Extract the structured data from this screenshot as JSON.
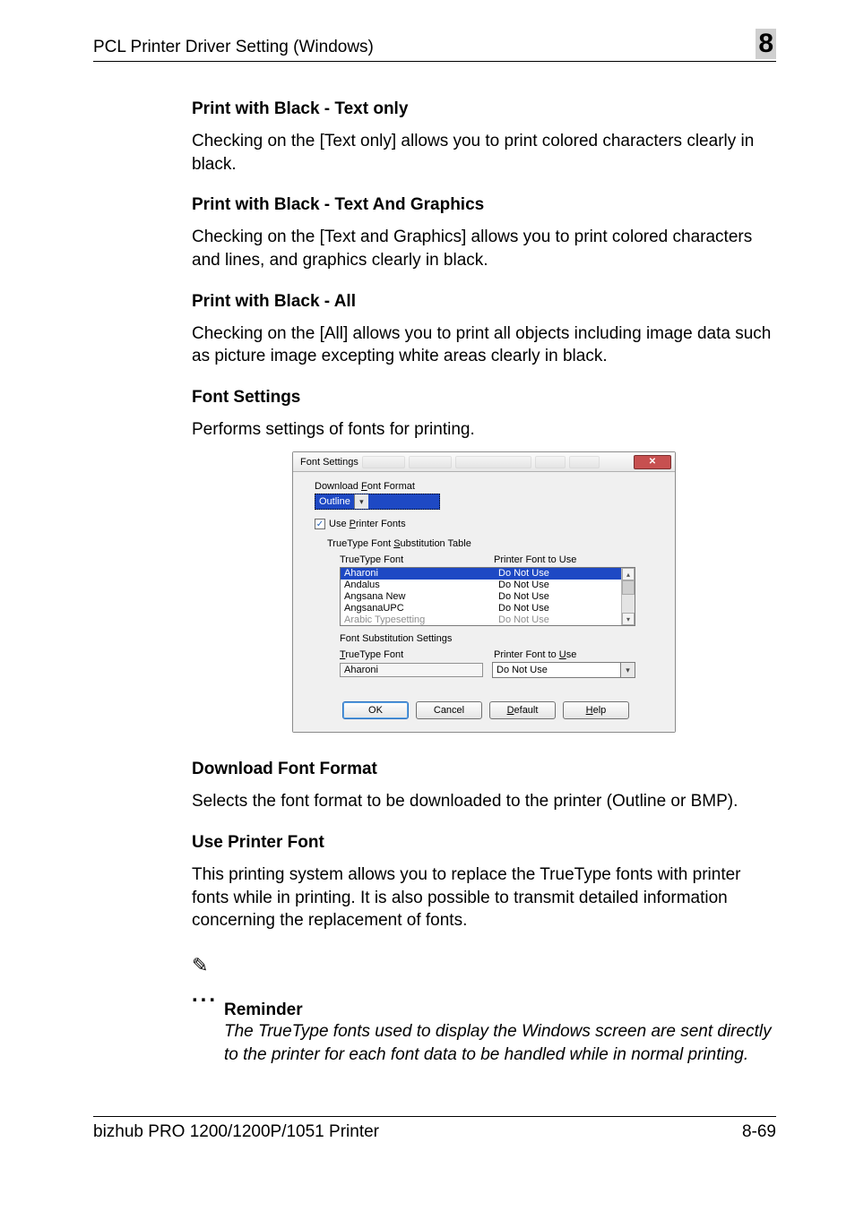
{
  "header": {
    "title": "PCL Printer Driver Setting (Windows)",
    "chapter": "8"
  },
  "sections": {
    "s1_title": "Print with Black - Text only",
    "s1_body": "Checking on the [Text only] allows you to print colored characters clearly in black.",
    "s2_title": "Print with Black - Text And Graphics",
    "s2_body": "Checking on the [Text and Graphics] allows you to print colored characters and lines, and graphics clearly in black.",
    "s3_title": "Print with Black - All",
    "s3_body": "Checking on the [All] allows you to print all objects including image data such as picture image excepting white areas clearly in black.",
    "s4_title": "Font Settings",
    "s4_body": "Performs settings of fonts for printing.",
    "s5_title": "Download Font Format",
    "s5_body": "Selects the font format to be downloaded to the printer (Outline or BMP).",
    "s6_title": "Use Printer Font",
    "s6_body": "This printing system allows you to replace the TrueType fonts with printer fonts while in printing. It is also possible to transmit detailed information concerning the replacement of fonts."
  },
  "dialog": {
    "title": "Font Settings",
    "close_glyph": "✕",
    "download_label_pre": "Download ",
    "download_label_u": "F",
    "download_label_post": "ont Format",
    "download_value": "Outline",
    "arrow_glyph": "▾",
    "arrow_up": "▴",
    "check_glyph": "✓",
    "use_printer_pre": "Use ",
    "use_printer_u": "P",
    "use_printer_post": "rinter Fonts",
    "subst_table_pre": "TrueType Font ",
    "subst_table_u": "S",
    "subst_table_post": "ubstitution Table",
    "col_truetype": "TrueType Font",
    "col_printer": "Printer Font to Use",
    "rows": {
      "r0_tt": "Aharoni",
      "r0_pf": "Do Not Use",
      "r1_tt": "Andalus",
      "r1_pf": "Do Not Use",
      "r2_tt": "Angsana New",
      "r2_pf": "Do Not Use",
      "r3_tt": "AngsanaUPC",
      "r3_pf": "Do Not Use",
      "r4_tt": "Arabic Typesetting",
      "r4_pf": "Do Not Use"
    },
    "font_sub_settings": "Font Substitution Settings",
    "ttfont_u": "T",
    "ttfont_post": "rueType Font",
    "printer_font_to_u": "U",
    "printer_font_to_pre": "Printer Font to ",
    "printer_font_to_post": "se",
    "sel_tt": "Aharoni",
    "sel_pf": "Do Not Use",
    "btn_ok": "OK",
    "btn_cancel": "Cancel",
    "btn_default_u": "D",
    "btn_default_post": "efault",
    "btn_help_u": "H",
    "btn_help_post": "elp"
  },
  "note": {
    "icon": "✎",
    "dots": "...",
    "title": "Reminder",
    "text": "The TrueType fonts used to display the Windows screen are sent directly to the printer for each font data to be handled while in normal printing."
  },
  "footer": {
    "left": "bizhub PRO 1200/1200P/1051 Printer",
    "right": "8-69"
  }
}
